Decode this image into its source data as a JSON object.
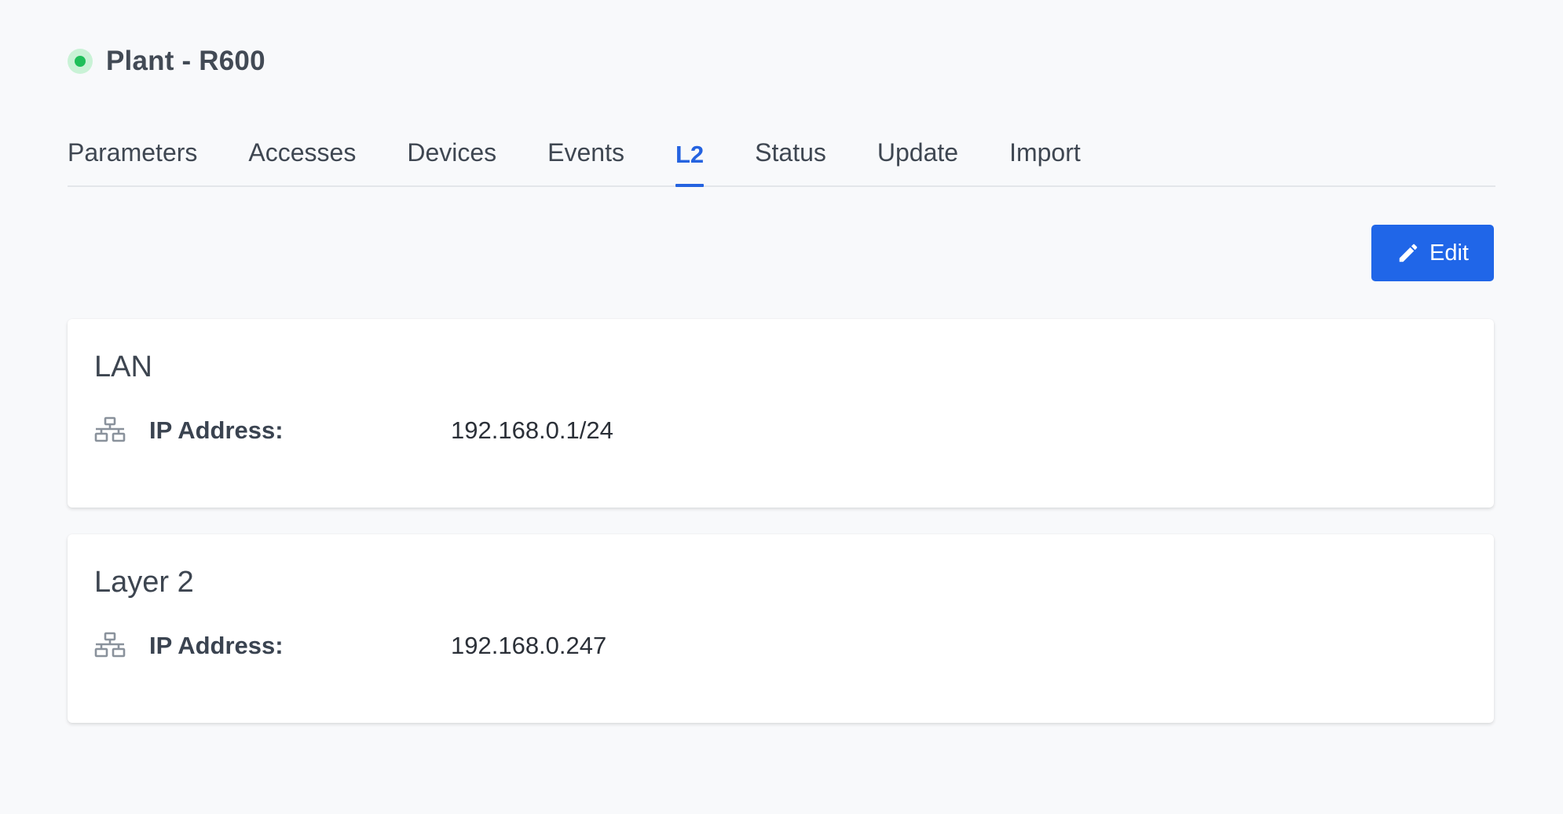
{
  "header": {
    "title": "Plant - R600",
    "status": "online",
    "status_color": "#1fbf5a"
  },
  "tabs": [
    {
      "label": "Parameters",
      "active": false
    },
    {
      "label": "Accesses",
      "active": false
    },
    {
      "label": "Devices",
      "active": false
    },
    {
      "label": "Events",
      "active": false
    },
    {
      "label": "L2",
      "active": true
    },
    {
      "label": "Status",
      "active": false
    },
    {
      "label": "Update",
      "active": false
    },
    {
      "label": "Import",
      "active": false
    }
  ],
  "toolbar": {
    "edit_label": "Edit",
    "edit_icon": "pencil-icon",
    "accent_color": "#2066e8"
  },
  "cards": [
    {
      "title": "LAN",
      "rows": [
        {
          "icon": "network-icon",
          "label": "IP Address:",
          "value": "192.168.0.1/24"
        }
      ]
    },
    {
      "title": "Layer 2",
      "rows": [
        {
          "icon": "network-icon",
          "label": "IP Address:",
          "value": "192.168.0.247"
        }
      ]
    }
  ]
}
